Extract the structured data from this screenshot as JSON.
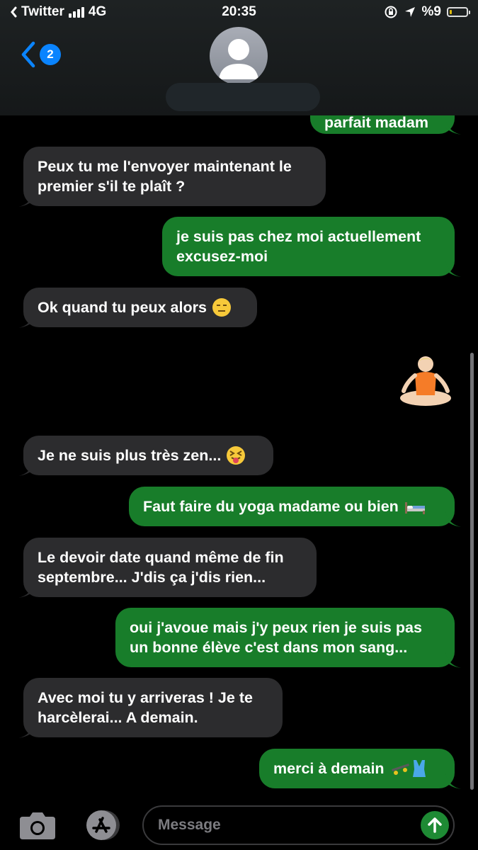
{
  "status_bar": {
    "carrier": "Twitter",
    "network": "4G",
    "time": "20:35",
    "battery": "%9",
    "battery_level": 0.09,
    "icons": [
      "signal-bars-icon",
      "screen-lock-rotation-icon",
      "location-arrow-icon",
      "battery-icon"
    ]
  },
  "header": {
    "back_badge": "2",
    "back_icon": "chevron-left-icon",
    "avatar_icon": "person-silhouette-icon",
    "contact_name": ""
  },
  "messages": [
    {
      "direction": "out",
      "text": "parfait madam"
    },
    {
      "direction": "in",
      "lines": [
        "Peux tu me l'envoyer maintenant le",
        "premier s'il te plaît ?"
      ]
    },
    {
      "direction": "out",
      "lines": [
        "je suis pas chez moi actuellement",
        "excusez-moi"
      ]
    },
    {
      "direction": "in",
      "text": "Ok quand tu peux alors",
      "emoji": "expressionless-face-emoji"
    },
    {
      "direction": "out",
      "sticker": "person-in-lotus-position-emoji"
    },
    {
      "direction": "in",
      "text": "Je ne suis plus très zen...",
      "emoji": "squinting-face-with-tongue-emoji"
    },
    {
      "direction": "out",
      "text": "Faut faire du yoga madame ou bien",
      "emoji": "bed-emoji"
    },
    {
      "direction": "in",
      "lines": [
        "Le devoir date quand même de fin",
        "septembre... J'dis ça j'dis rien..."
      ]
    },
    {
      "direction": "out",
      "lines": [
        "oui j'avoue mais j'y peux rien je suis pas",
        "un bonne élève c'est dans mon sang..."
      ]
    },
    {
      "direction": "in",
      "lines": [
        "Avec moi tu y arriveras ! Je te",
        "harcèlerai... A demain."
      ]
    },
    {
      "direction": "out",
      "text": "merci à demain",
      "emoji": [
        "skateboard-emoji",
        "one-piece-swimsuit-emoji"
      ]
    }
  ],
  "composer": {
    "camera_icon": "camera-icon",
    "apps_icon": "app-store-icon",
    "placeholder": "Message",
    "send_icon": "arrow-up-icon"
  },
  "colors": {
    "background": "#000000",
    "incoming_bubble": "#2c2c2e",
    "outgoing_bubble": "#187d2a",
    "accent_blue": "#0a84ff",
    "send_button": "#1e8a34"
  }
}
